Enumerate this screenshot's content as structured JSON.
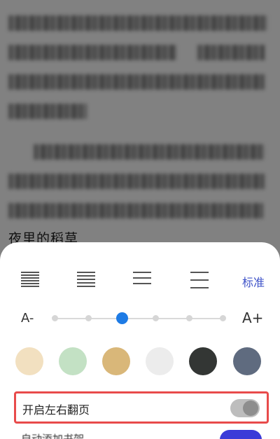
{
  "reader": {
    "visible_line": "夜里的稻草"
  },
  "sheet": {
    "spacing_icons": [
      "line-spacing-dense-icon",
      "line-spacing-compact-icon",
      "line-spacing-normal-icon",
      "line-spacing-loose-icon"
    ],
    "spacing_standard_label": "标准",
    "font_decrease_label": "A-",
    "font_increase_label": "A+",
    "font_size_level": 3,
    "font_size_steps": 6,
    "background_colors": [
      {
        "name": "cream",
        "hex": "#f2e0c0"
      },
      {
        "name": "mint",
        "hex": "#c3e1c4"
      },
      {
        "name": "tan",
        "hex": "#d9b779"
      },
      {
        "name": "light-gray",
        "hex": "#ececec"
      },
      {
        "name": "dark",
        "hex": "#333634"
      },
      {
        "name": "slate",
        "hex": "#5f6b7f"
      }
    ],
    "flip_label": "开启左右翻页",
    "flip_enabled": false,
    "next_row_label": "自动添加书架"
  },
  "colors": {
    "accent_blue": "#3e52c8",
    "slider_blue": "#1e7be5",
    "highlight_red": "#e84b4b"
  }
}
